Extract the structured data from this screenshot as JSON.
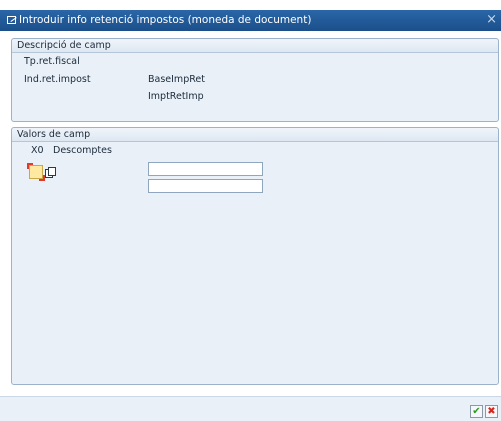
{
  "window": {
    "title": "Introduir info retenció impostos (moneda de document)",
    "close_symbol": "×"
  },
  "field_description": {
    "header": "Descripció de camp",
    "tp_ret_fiscal": "Tp.ret.fiscal",
    "ind_ret_impost": "Ind.ret.impost",
    "base_imp_ret": "BaseImpRet",
    "impt_ret_imp": "ImptRetImp"
  },
  "field_values": {
    "header": "Valors de camp",
    "code": "X0",
    "description": "Descomptes",
    "base_value": "",
    "amount_value": ""
  },
  "footer": {
    "confirm_symbol": "✔",
    "cancel_symbol": "✖"
  },
  "icons": [
    "dialog-icon",
    "close-icon",
    "checkbox-icon",
    "copy-icon",
    "confirm-icon",
    "cancel-icon"
  ],
  "colors": {
    "titlebar": "#1f5a9a",
    "group_background": "#e9f0f8",
    "confirm": "#2c9a22",
    "cancel": "#d2271c",
    "checkbox_highlight": "#ffe9a0"
  }
}
